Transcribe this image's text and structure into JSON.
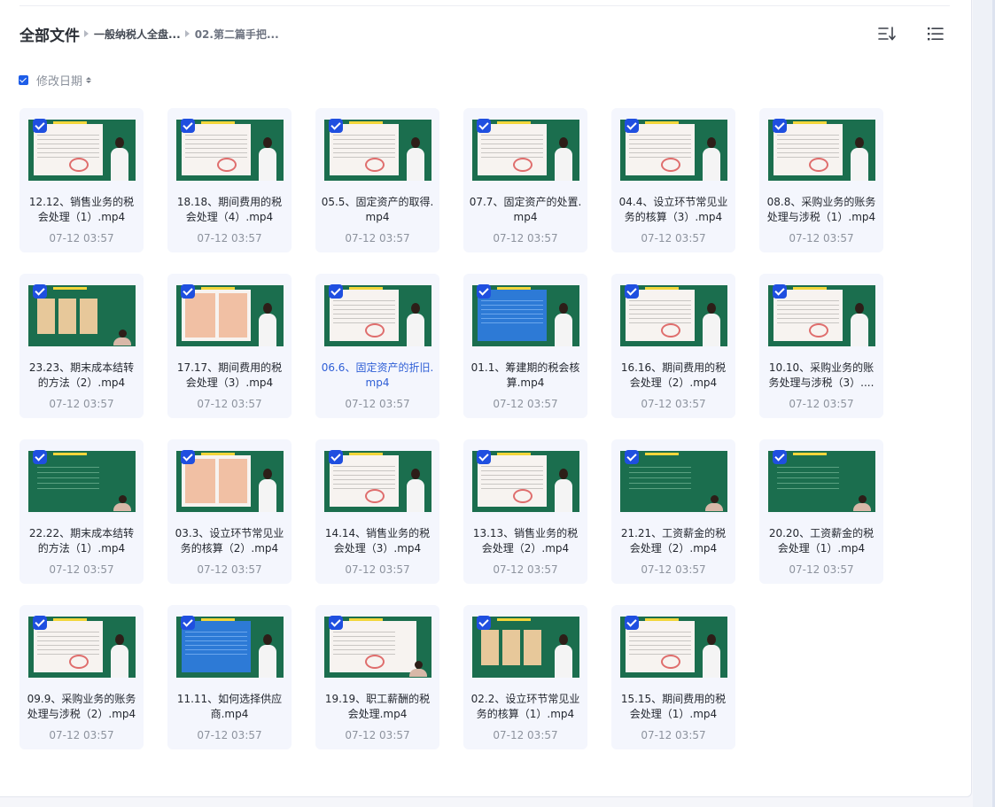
{
  "breadcrumb": {
    "root": "全部文件",
    "level1": "一般纳税人全盘...",
    "level2": "02.第二篇手把..."
  },
  "toolbar": {
    "sort_icon": "sort-descending-icon",
    "view_icon": "list-view-icon"
  },
  "sort": {
    "label": "修改日期",
    "select_all_checked": true
  },
  "colors": {
    "accent": "#1f4fe0",
    "link": "#2f5fd6",
    "thumb_bg": "#1b6e4e"
  },
  "files": [
    {
      "name": "12.12、销售业务的税会处理（1）.mp4",
      "date": "07-12 03:57",
      "thumb": "doc"
    },
    {
      "name": "18.18、期间费用的税会处理（4）.mp4",
      "date": "07-12 03:57",
      "thumb": "doc"
    },
    {
      "name": "05.5、固定资产的取得.mp4",
      "date": "07-12 03:57",
      "thumb": "doc"
    },
    {
      "name": "07.7、固定资产的处置.mp4",
      "date": "07-12 03:57",
      "thumb": "doc"
    },
    {
      "name": "04.4、设立环节常见业务的核算（3）.mp4",
      "date": "07-12 03:57",
      "thumb": "doc"
    },
    {
      "name": "08.8、采购业务的账务处理与涉税（1）.mp4",
      "date": "07-12 03:57",
      "thumb": "doc"
    },
    {
      "name": "23.23、期末成本结转的方法（2）.mp4",
      "date": "07-12 03:57",
      "thumb": "slides cam"
    },
    {
      "name": "17.17、期间费用的税会处理（3）.mp4",
      "date": "07-12 03:57",
      "thumb": "pink"
    },
    {
      "name": "06.6、固定资产的折旧.mp4",
      "date": "07-12 03:57",
      "thumb": "doc",
      "active": true
    },
    {
      "name": "01.1、筹建期的税会核算.mp4",
      "date": "07-12 03:57",
      "thumb": "blue"
    },
    {
      "name": "16.16、期间费用的税会处理（2）.mp4",
      "date": "07-12 03:57",
      "thumb": "doc"
    },
    {
      "name": "10.10、采购业务的账务处理与涉税（3）....",
      "date": "07-12 03:57",
      "thumb": "doc"
    },
    {
      "name": "22.22、期末成本结转的方法（1）.mp4",
      "date": "07-12 03:57",
      "thumb": "table cam"
    },
    {
      "name": "03.3、设立环节常见业务的核算（2）.mp4",
      "date": "07-12 03:57",
      "thumb": "pink"
    },
    {
      "name": "14.14、销售业务的税会处理（3）.mp4",
      "date": "07-12 03:57",
      "thumb": "doc"
    },
    {
      "name": "13.13、销售业务的税会处理（2）.mp4",
      "date": "07-12 03:57",
      "thumb": "doc"
    },
    {
      "name": "21.21、工资薪金的税会处理（2）.mp4",
      "date": "07-12 03:57",
      "thumb": "table cam"
    },
    {
      "name": "20.20、工资薪金的税会处理（1）.mp4",
      "date": "07-12 03:57",
      "thumb": "table cam"
    },
    {
      "name": "09.9、采购业务的账务处理与涉税（2）.mp4",
      "date": "07-12 03:57",
      "thumb": "doc"
    },
    {
      "name": "11.11、如何选择供应商.mp4",
      "date": "07-12 03:57",
      "thumb": "blue"
    },
    {
      "name": "19.19、职工薪酬的税会处理.mp4",
      "date": "07-12 03:57",
      "thumb": "doc cam"
    },
    {
      "name": "02.2、设立环节常见业务的核算（1）.mp4",
      "date": "07-12 03:57",
      "thumb": "slides"
    },
    {
      "name": "15.15、期间费用的税会处理（1）.mp4",
      "date": "07-12 03:57",
      "thumb": "doc"
    }
  ]
}
